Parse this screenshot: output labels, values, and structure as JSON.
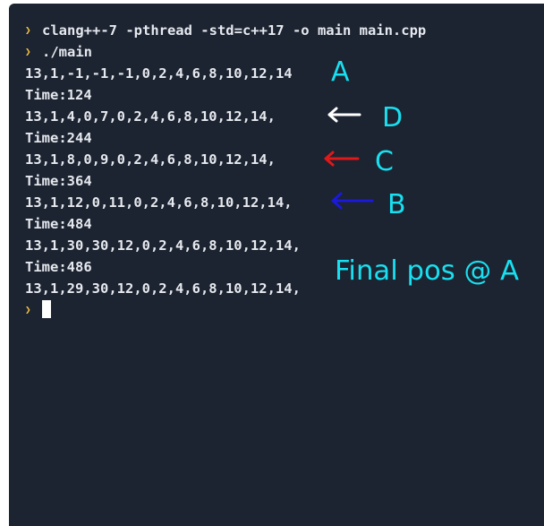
{
  "terminal": {
    "prompt_symbol": "❯",
    "lines": [
      {
        "type": "command",
        "text": "clang++-7 -pthread -std=c++17 -o main main.cpp"
      },
      {
        "type": "command",
        "text": "./main"
      },
      {
        "type": "output",
        "text": "13,1,-1,-1,-1,0,2,4,6,8,10,12,14"
      },
      {
        "type": "output",
        "text": "Time:124"
      },
      {
        "type": "output",
        "text": "13,1,4,0,7,0,2,4,6,8,10,12,14,"
      },
      {
        "type": "output",
        "text": "Time:244"
      },
      {
        "type": "output",
        "text": "13,1,8,0,9,0,2,4,6,8,10,12,14,"
      },
      {
        "type": "output",
        "text": "Time:364"
      },
      {
        "type": "output",
        "text": "13,1,12,0,11,0,2,4,6,8,10,12,14,"
      },
      {
        "type": "output",
        "text": "Time:484"
      },
      {
        "type": "output",
        "text": "13,1,30,30,12,0,2,4,6,8,10,12,14,"
      },
      {
        "type": "output",
        "text": "Time:486"
      },
      {
        "type": "output",
        "text": "13,1,29,30,12,0,2,4,6,8,10,12,14,"
      }
    ]
  },
  "annotations": {
    "label_a": "A",
    "label_d": "D",
    "label_c": "C",
    "label_b": "B",
    "final_note": "Final pos @ A",
    "colors": {
      "cyan": "#18e0f0",
      "white": "#ffffff",
      "red": "#e01818",
      "blue": "#1a1ad8"
    }
  }
}
